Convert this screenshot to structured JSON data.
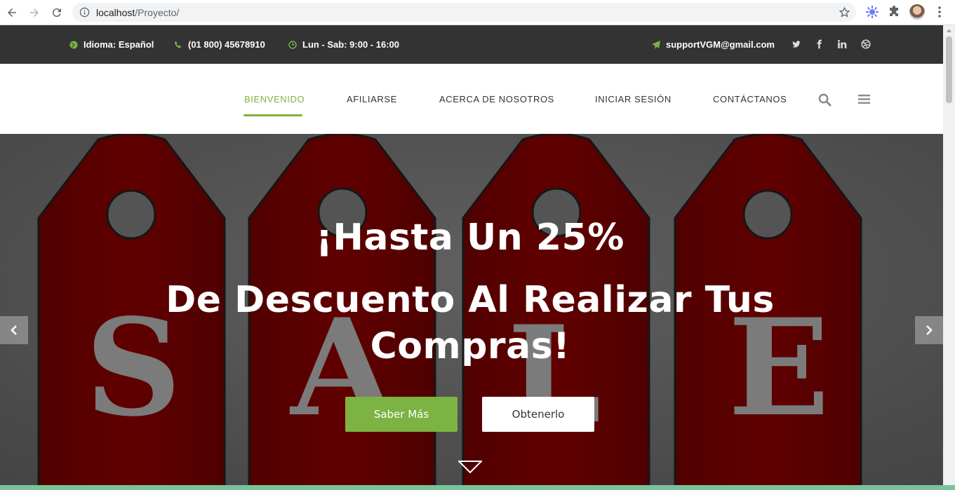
{
  "browser": {
    "url_host": "localhost",
    "url_path": "/Proyecto/"
  },
  "topbar": {
    "language": "Idioma: Español",
    "phone": "(01 800) 45678910",
    "hours": "Lun - Sab: 9:00 - 16:00",
    "email": "supportVGM@gmail.com",
    "icons": [
      "globe-icon",
      "phone-icon",
      "clock-icon",
      "send-icon",
      "twitter-icon",
      "facebook-icon",
      "linkedin-icon",
      "dribbble-icon"
    ]
  },
  "nav": {
    "items": [
      {
        "label": "BIENVENIDO",
        "active": true
      },
      {
        "label": "AFILIARSE",
        "active": false
      },
      {
        "label": "ACERCA DE NOSOTROS",
        "active": false
      },
      {
        "label": "INICIAR SESIÓN",
        "active": false
      },
      {
        "label": "CONTÁCTANOS",
        "active": false
      }
    ],
    "accent": "#7cb342"
  },
  "hero": {
    "line1": "¡Hasta Un 25%",
    "line2a": "De Descuento Al Realizar Tus",
    "line2b": "Compras!",
    "primary_button": "Saber Más",
    "secondary_button": "Obtenerlo",
    "tag_letters": [
      "S",
      "A",
      "L",
      "E"
    ],
    "tag_color": "#6e0000"
  }
}
